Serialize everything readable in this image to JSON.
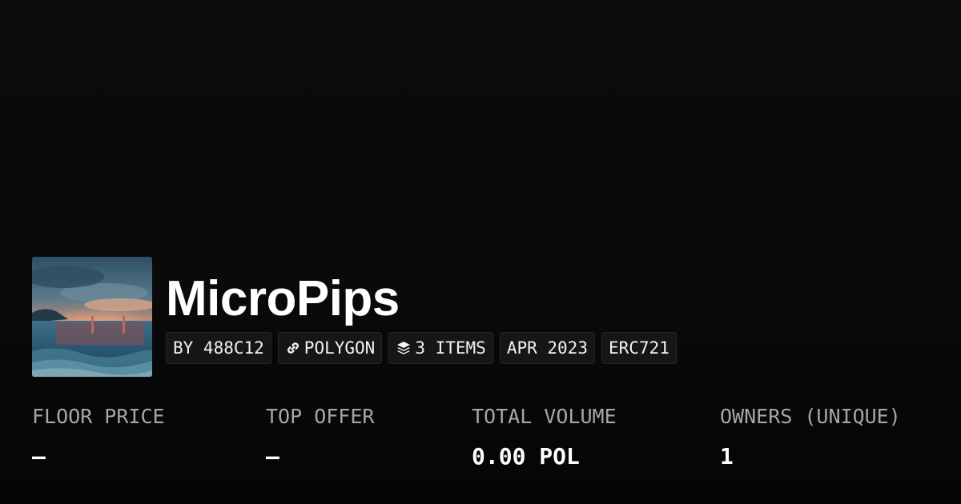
{
  "collection": {
    "name": "MicroPips",
    "thumbnail_icon": "ocean-sunset-artwork"
  },
  "badges": {
    "creator": "BY 488C12",
    "chain": "POLYGON",
    "chain_icon": "link-icon",
    "items": "3 ITEMS",
    "items_icon": "layers-icon",
    "created": "APR 2023",
    "standard": "ERC721"
  },
  "stats": {
    "floor_price": {
      "label": "FLOOR PRICE",
      "value": "–"
    },
    "top_offer": {
      "label": "TOP OFFER",
      "value": "–"
    },
    "total_volume": {
      "label": "TOTAL VOLUME",
      "value": "0.00 POL"
    },
    "owners": {
      "label": "OWNERS (UNIQUE)",
      "value": "1"
    }
  },
  "colors": {
    "background": "#0a0a0a",
    "badge_background": "#161616",
    "label_text": "#a6a6a6",
    "value_text": "#ffffff"
  }
}
